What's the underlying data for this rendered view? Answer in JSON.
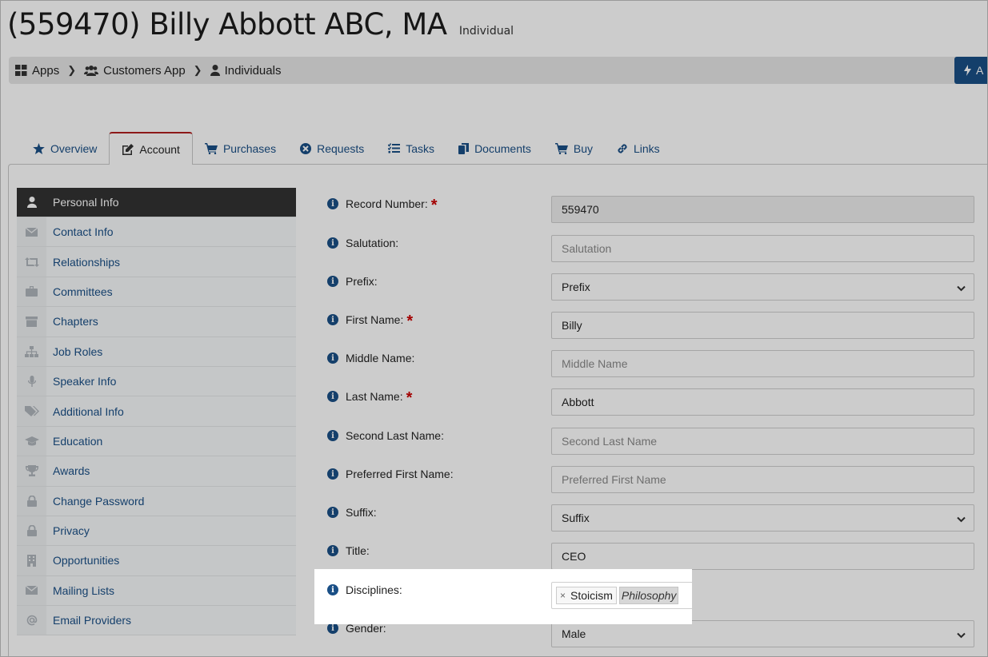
{
  "header": {
    "title": "(559470) Billy Abbott ABC, MA",
    "subtitle": "Individual"
  },
  "breadcrumb": [
    {
      "label": "Apps",
      "icon": "grid-icon"
    },
    {
      "label": "Customers App",
      "icon": "users-icon"
    },
    {
      "label": "Individuals",
      "icon": "user-icon"
    }
  ],
  "action_button": {
    "label": "A",
    "icon": "bolt-icon",
    "color": "#1a4f86"
  },
  "tabs": [
    {
      "label": "Overview",
      "icon": "star-icon"
    },
    {
      "label": "Account",
      "icon": "edit-icon",
      "active": true
    },
    {
      "label": "Purchases",
      "icon": "cart-icon"
    },
    {
      "label": "Requests",
      "icon": "times-circle-icon"
    },
    {
      "label": "Tasks",
      "icon": "tasks-icon"
    },
    {
      "label": "Documents",
      "icon": "copy-icon"
    },
    {
      "label": "Buy",
      "icon": "cart-icon"
    },
    {
      "label": "Links",
      "icon": "link-icon"
    }
  ],
  "sidebar": {
    "items": [
      {
        "label": "Personal Info",
        "icon": "user-icon",
        "active": true
      },
      {
        "label": "Contact Info",
        "icon": "envelope-icon"
      },
      {
        "label": "Relationships",
        "icon": "retweet-icon"
      },
      {
        "label": "Committees",
        "icon": "briefcase-icon"
      },
      {
        "label": "Chapters",
        "icon": "archive-icon"
      },
      {
        "label": "Job Roles",
        "icon": "sitemap-icon"
      },
      {
        "label": "Speaker Info",
        "icon": "microphone-icon"
      },
      {
        "label": "Additional Info",
        "icon": "tags-icon"
      },
      {
        "label": "Education",
        "icon": "graduation-cap-icon"
      },
      {
        "label": "Awards",
        "icon": "trophy-icon"
      },
      {
        "label": "Change Password",
        "icon": "lock-icon"
      },
      {
        "label": "Privacy",
        "icon": "lock-icon"
      },
      {
        "label": "Opportunities",
        "icon": "building-icon"
      },
      {
        "label": "Mailing Lists",
        "icon": "envelope-icon"
      },
      {
        "label": "Email Providers",
        "icon": "at-icon"
      }
    ]
  },
  "form": {
    "record_number": {
      "label": "Record Number:",
      "value": "559470",
      "required": "*"
    },
    "salutation": {
      "label": "Salutation:",
      "placeholder": "Salutation"
    },
    "prefix": {
      "label": "Prefix:",
      "value": "Prefix"
    },
    "first_name": {
      "label": "First Name:",
      "value": "Billy",
      "required": "*"
    },
    "middle_name": {
      "label": "Middle Name:",
      "placeholder": "Middle Name"
    },
    "last_name": {
      "label": "Last Name:",
      "value": "Abbott",
      "required": "*"
    },
    "second_last_name": {
      "label": "Second Last Name:",
      "placeholder": "Second Last Name"
    },
    "preferred_first_name": {
      "label": "Preferred First Name:",
      "placeholder": "Preferred First Name"
    },
    "suffix": {
      "label": "Suffix:",
      "value": "Suffix"
    },
    "title": {
      "label": "Title:",
      "value": "CEO"
    },
    "disciplines": {
      "label": "Disciplines:",
      "tag": "Stoicism",
      "tag_remove": "×",
      "input_value": "Philosophy"
    },
    "gender": {
      "label": "Gender:",
      "value": "Male"
    }
  }
}
